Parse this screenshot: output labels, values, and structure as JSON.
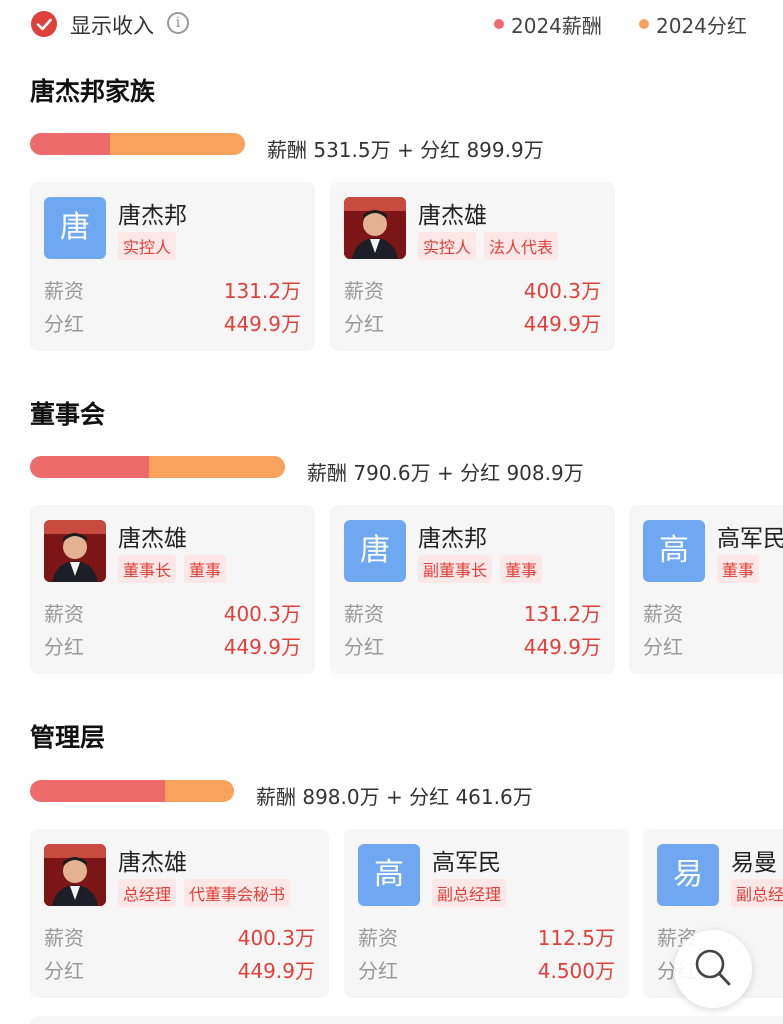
{
  "header": {
    "toggle_label": "显示收入",
    "legend": [
      {
        "label": "2024薪酬",
        "color": "#ed6b6b"
      },
      {
        "label": "2024分红",
        "color": "#f7a35e"
      }
    ]
  },
  "sections": [
    {
      "title": "唐杰邦家族",
      "bar_salary_fraction": 0.371,
      "summary": "薪酬 531.5万 + 分红 899.9万",
      "cards": [
        {
          "avatar": "唐",
          "name": "唐杰邦",
          "tags": [
            "实控人"
          ],
          "salary_label": "薪资",
          "salary": "131.2万",
          "dividend_label": "分红",
          "dividend": "449.9万"
        },
        {
          "avatar": "photo",
          "name": "唐杰雄",
          "tags": [
            "实控人",
            "法人代表"
          ],
          "salary_label": "薪资",
          "salary": "400.3万",
          "dividend_label": "分红",
          "dividend": "449.9万"
        }
      ]
    },
    {
      "title": "董事会",
      "bar_salary_fraction": 0.465,
      "summary": "薪酬 790.6万 + 分红 908.9万",
      "cards": [
        {
          "avatar": "photo",
          "name": "唐杰雄",
          "tags": [
            "董事长",
            "董事"
          ],
          "salary_label": "薪资",
          "salary": "400.3万",
          "dividend_label": "分红",
          "dividend": "449.9万"
        },
        {
          "avatar": "唐",
          "name": "唐杰邦",
          "tags": [
            "副董事长",
            "董事"
          ],
          "salary_label": "薪资",
          "salary": "131.2万",
          "dividend_label": "分红",
          "dividend": "449.9万"
        },
        {
          "avatar": "高",
          "name": "高军民",
          "tags": [
            "董事"
          ],
          "salary_label": "薪资",
          "salary": "",
          "dividend_label": "分红",
          "dividend": ""
        }
      ]
    },
    {
      "title": "管理层",
      "bar_salary_fraction": 0.66,
      "summary": "薪酬 898.0万 + 分红 461.6万",
      "cards": [
        {
          "avatar": "photo",
          "name": "唐杰雄",
          "tags": [
            "总经理",
            "代董事会秘书"
          ],
          "salary_label": "薪资",
          "salary": "400.3万",
          "dividend_label": "分红",
          "dividend": "449.9万"
        },
        {
          "avatar": "高",
          "name": "高军民",
          "tags": [
            "副总经理"
          ],
          "salary_label": "薪资",
          "salary": "112.5万",
          "dividend_label": "分红",
          "dividend": "4.500万"
        },
        {
          "avatar": "易",
          "name": "易曼",
          "tags": [
            "副总经"
          ],
          "salary_label": "薪资",
          "salary": "",
          "dividend_label": "分红",
          "dividend": ""
        }
      ]
    }
  ],
  "fab": {
    "icon": "search-icon"
  }
}
